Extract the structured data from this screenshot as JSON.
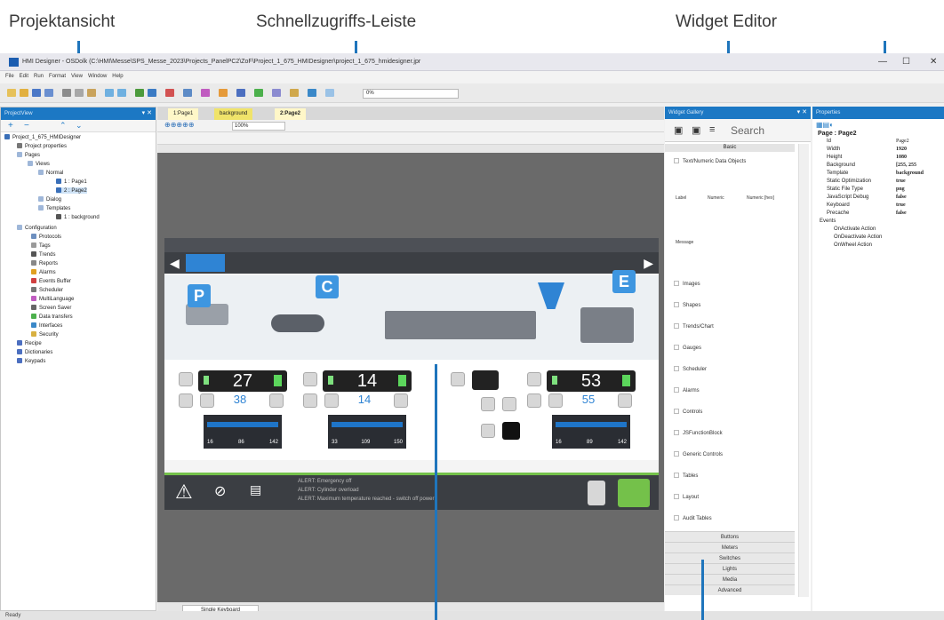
{
  "callouts": {
    "projektansicht": "Projektansicht",
    "schnellzugriff": "Schnellzugriffs-Leiste",
    "widget_editor": "Widget Editor"
  },
  "window": {
    "title": "HMI Designer - OSDolk (C:\\HMI\\Messe\\SPS_Messe_2023\\Projects_PanelPC2\\ZoF\\Project_1_675_HMIDesigner\\project_1_675_hmidesigner.jpr",
    "minimize": "—",
    "maximize": "☐",
    "close": "✕"
  },
  "menu": [
    "File",
    "Edit",
    "Run",
    "Format",
    "View",
    "Window",
    "Help"
  ],
  "toolbar": {
    "combo_value": "0%"
  },
  "project_view": {
    "title": "ProjectView",
    "items": [
      "Project_1_675_HMIDesigner",
      "Project properties",
      "Pages",
      "Views",
      "Normal",
      "1 : Page1",
      "2 : Page2",
      "Dialog",
      "Templates",
      "1 : background",
      "Configuration",
      "Protocols",
      "Tags",
      "Trends",
      "Reports",
      "Alarms",
      "Events Buffer",
      "Scheduler",
      "MultiLanguage",
      "Screen Saver",
      "Data transfers",
      "Interfaces",
      "Security",
      "Recipe",
      "Dictionaries",
      "Keypads"
    ],
    "footer": "Single Keyboard"
  },
  "editor": {
    "tabs": [
      "1:Page1",
      "background",
      "2:Page2"
    ],
    "zoom": "100%"
  },
  "hmi": {
    "badges": [
      "P",
      "C",
      "E"
    ],
    "gauge1_value": "27",
    "gauge1_sub": "38",
    "gauge2_value": "14",
    "gauge2_sub": "14",
    "gauge3_value": "53",
    "gauge3_sub": "55",
    "scale1": [
      "16",
      "86",
      "142"
    ],
    "scale2": [
      "33",
      "109",
      "150"
    ],
    "scale3": [
      "16",
      "89",
      "142"
    ],
    "msg1": "ALERT: Emergency off",
    "msg2": "ALERT: Cylinder overload",
    "msg3": "ALERT: Maximum temperature reached - switch off power"
  },
  "gallery": {
    "title": "Widget Gallery",
    "search_placeholder": "Search",
    "header": "Basic",
    "section": "Text/Numeric Data Objects",
    "basic_items": [
      "Label",
      "Numeric",
      "Numeric [hex]",
      "Message"
    ],
    "items": [
      "Images",
      "Shapes",
      "Trends/Chart",
      "Gauges",
      "Scheduler",
      "Alarms",
      "Controls",
      "JSFunctionBlock",
      "Generic Controls",
      "Tables",
      "Layout",
      "Audit Tables"
    ],
    "subsections": [
      "Buttons",
      "Meters",
      "Switches",
      "Lights",
      "Media",
      "Advanced"
    ]
  },
  "properties": {
    "title": "Properties",
    "object": "Page : Page2",
    "rows": [
      [
        "Id",
        "Page2"
      ],
      [
        "Width",
        "1920"
      ],
      [
        "Height",
        "1080"
      ],
      [
        "Background",
        "[255, 255"
      ],
      [
        "Template",
        "background"
      ],
      [
        "Static Optimization",
        "true"
      ],
      [
        "Static File Type",
        "png"
      ],
      [
        "JavaScript Debug",
        "false"
      ],
      [
        "Keyboard",
        "true"
      ],
      [
        "Precache",
        "false"
      ],
      [
        "Events",
        ""
      ],
      [
        "OnActivate Action",
        ""
      ],
      [
        "OnDeactivate Action",
        ""
      ],
      [
        "OnWheel Action",
        ""
      ]
    ]
  },
  "status": {
    "ready": "Ready"
  }
}
